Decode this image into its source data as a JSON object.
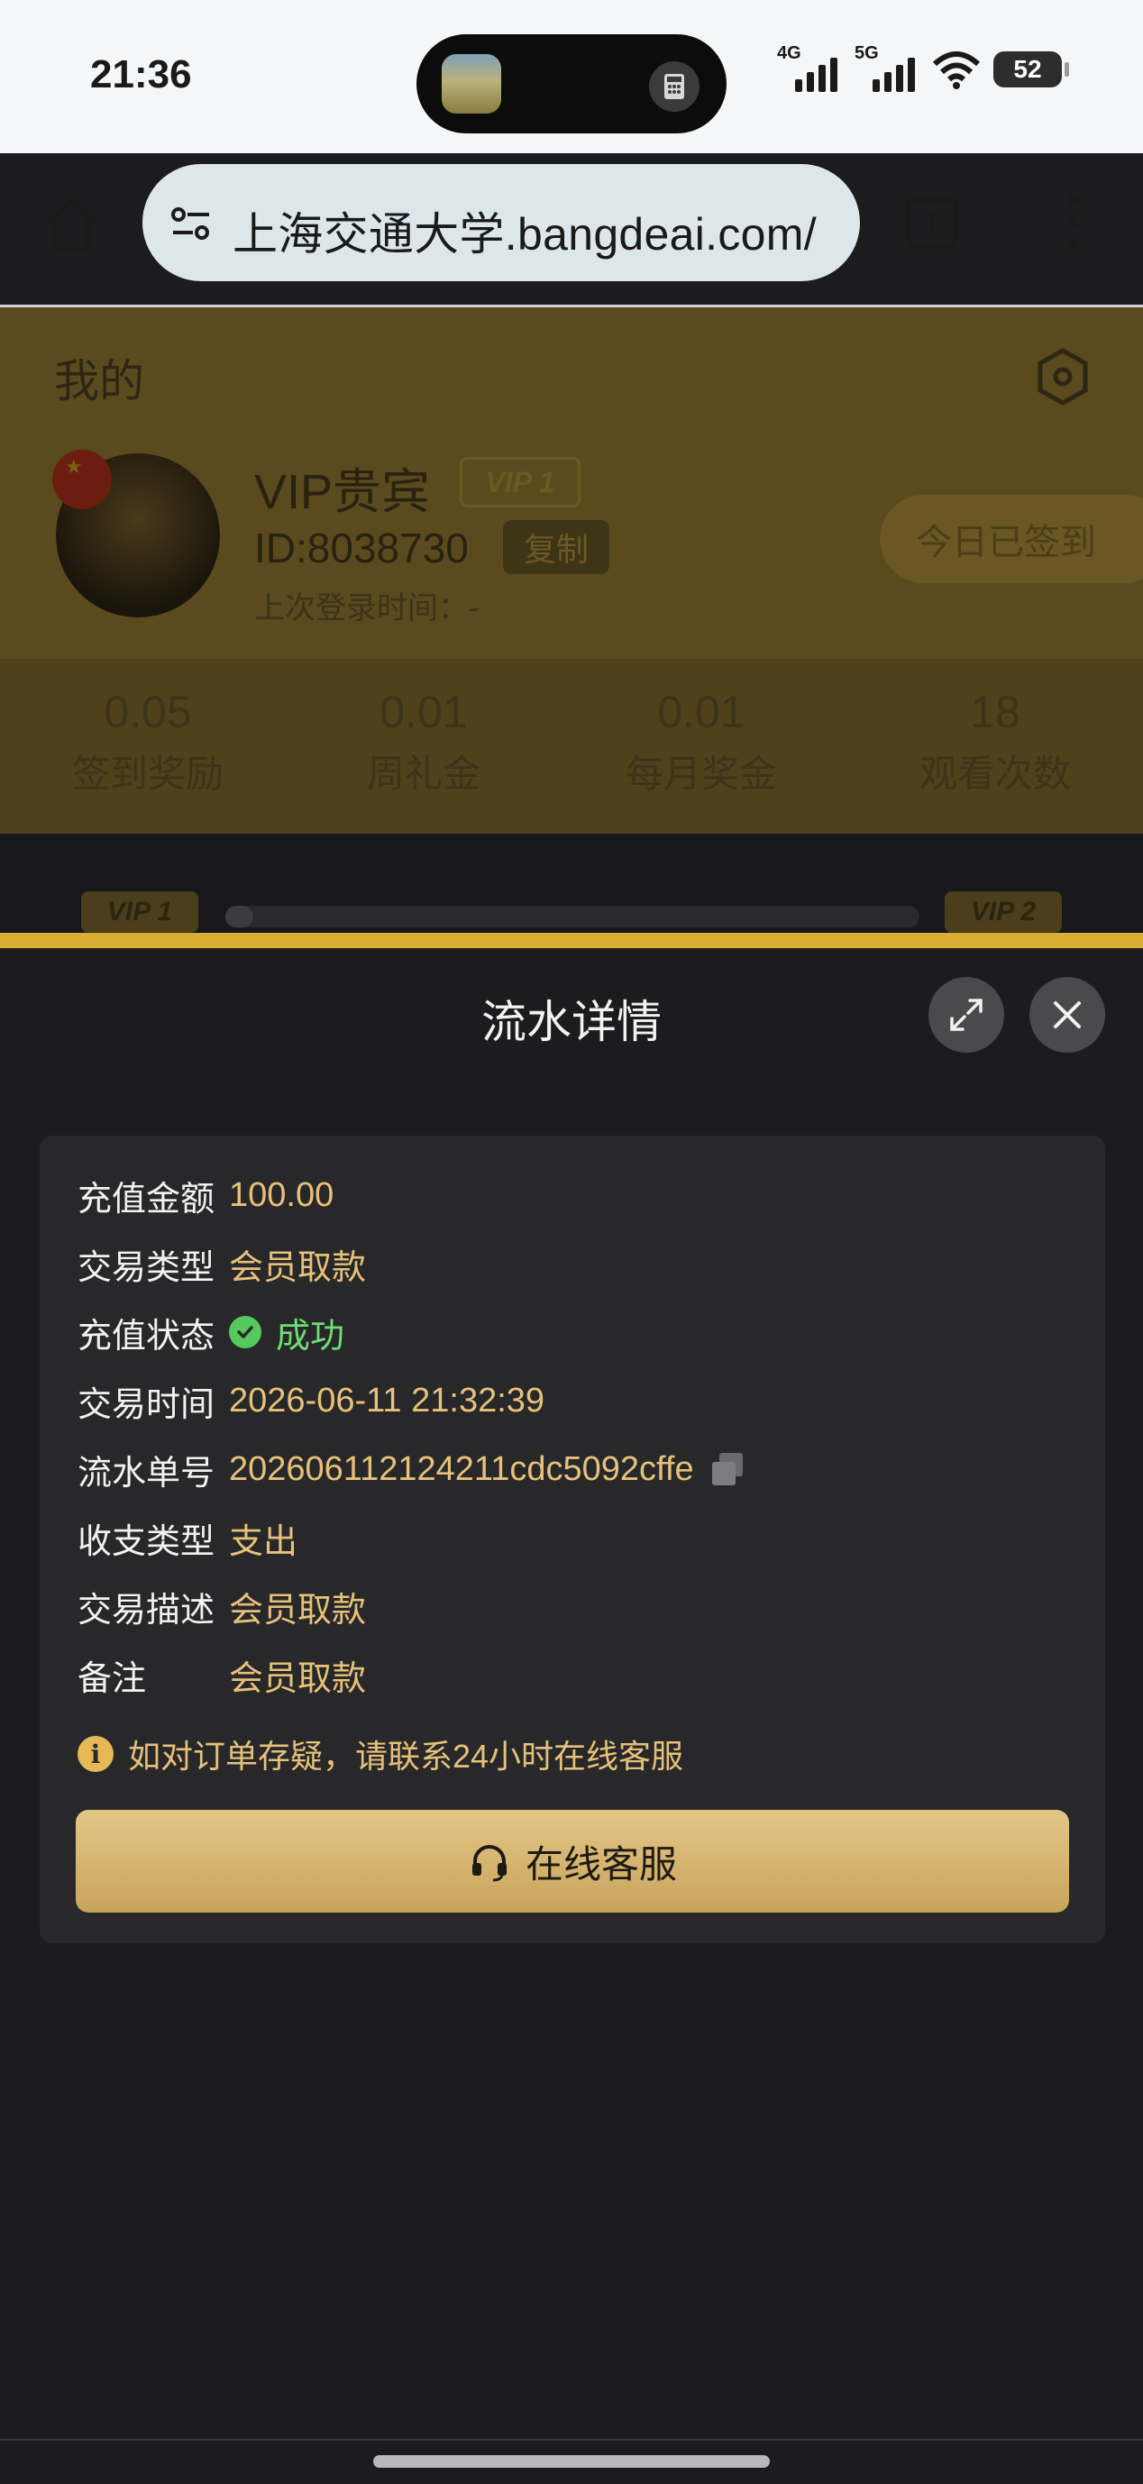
{
  "status_bar": {
    "time": "21:36",
    "network1": "4G",
    "network2": "5G",
    "battery": "52"
  },
  "browser": {
    "url": "上海交通大学.bangdeai.com/",
    "tab_count": "1"
  },
  "profile": {
    "title": "我的",
    "username": "VIP贵宾",
    "vip_badge": "VIP 1",
    "id_text": "ID:8038730",
    "copy_label": "复制",
    "last_login": "上次登录时间：-",
    "checkin_label": "今日已签到"
  },
  "stats": [
    {
      "value": "0.05",
      "label": "签到奖励"
    },
    {
      "value": "0.01",
      "label": "周礼金"
    },
    {
      "value": "0.01",
      "label": "每月奖金"
    },
    {
      "value": "18",
      "label": "观看次数"
    }
  ],
  "vip_progress": {
    "current": "VIP 1",
    "next": "VIP 2",
    "fraction": 0.04
  },
  "sheet": {
    "title": "流水详情",
    "rows": [
      {
        "key": "充值金额",
        "value": "100.00"
      },
      {
        "key": "交易类型",
        "value": "会员取款"
      },
      {
        "key": "充值状态",
        "value": "成功"
      },
      {
        "key": "交易时间",
        "value": "2026-06-11 21:32:39"
      },
      {
        "key": "流水单号",
        "value": "202606112124211cdc5092cffe"
      },
      {
        "key": "收支类型",
        "value": "支出"
      },
      {
        "key": "交易描述",
        "value": "会员取款"
      },
      {
        "key": "备注",
        "value": "会员取款"
      }
    ],
    "notice": "如对订单存疑，请联系24小时在线客服",
    "service_button": "在线客服"
  },
  "colors": {
    "gold_text": "#e6c17a",
    "success_green": "#6fdc74",
    "button_gold": "#d6b46f"
  }
}
